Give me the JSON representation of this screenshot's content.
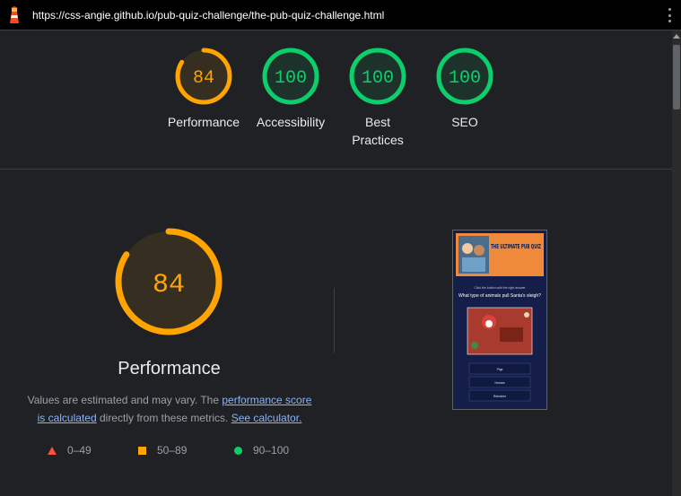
{
  "browser": {
    "url": "https://css-angie.github.io/pub-quiz-challenge/the-pub-quiz-challenge.html",
    "logo_icon": "lighthouse-icon",
    "menu_icon": "kebab-menu-icon"
  },
  "gauges": [
    {
      "score": "84",
      "label": "Performance",
      "fraction": 0.84,
      "color": "#ffa400"
    },
    {
      "score": "100",
      "label": "Accessibility",
      "fraction": 1.0,
      "color": "#0cce6b"
    },
    {
      "score": "100",
      "label": "Best Practices",
      "fraction": 1.0,
      "color": "#0cce6b"
    },
    {
      "score": "100",
      "label": "SEO",
      "fraction": 1.0,
      "color": "#0cce6b"
    }
  ],
  "performance": {
    "score": "84",
    "fraction": 0.84,
    "title": "Performance",
    "desc_prefix": "Values are estimated and may vary. The ",
    "link_score": "performance score is calculated",
    "desc_mid": " directly from these metrics. ",
    "link_calc": "See calculator."
  },
  "legend": [
    {
      "range": "0–49",
      "icon": "triangle-icon",
      "color": "#ff4e42"
    },
    {
      "range": "50–89",
      "icon": "square-icon",
      "color": "#ffa400"
    },
    {
      "range": "90–100",
      "icon": "circle-icon",
      "color": "#0cce6b"
    }
  ],
  "screenshot": {
    "heading": "THE ULTIMATE PUB QUIZ",
    "prompt": "Click the button with the right answer",
    "question": "What type of animals pull Santa's sleigh?",
    "answers": [
      "Pigs",
      "Horses",
      "Reindeer"
    ]
  }
}
